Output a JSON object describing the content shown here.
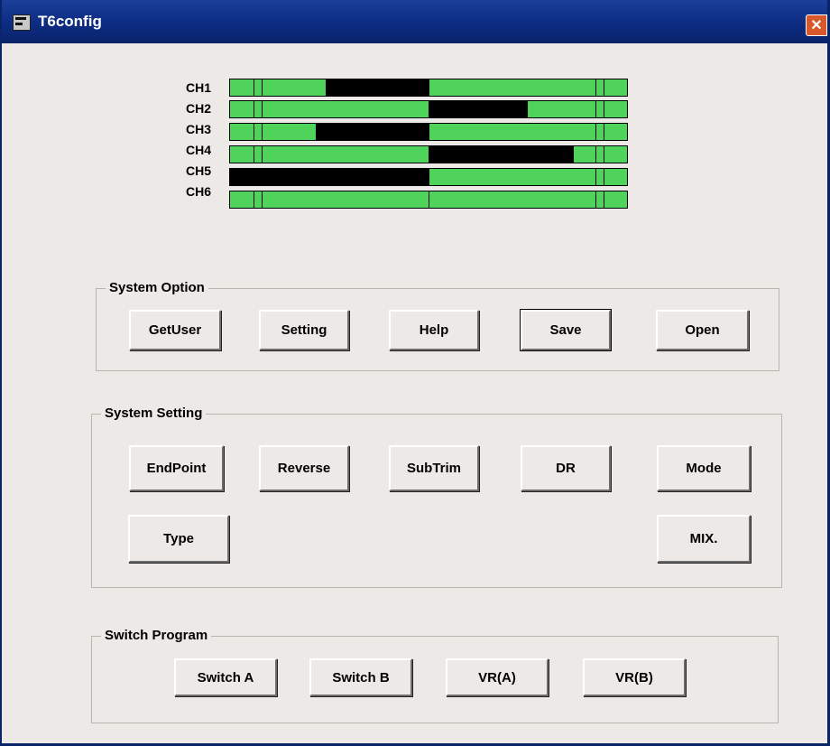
{
  "window": {
    "title": "T6config",
    "close_glyph": "✕"
  },
  "channels": [
    {
      "label": "CH1",
      "fill_start": 0.24,
      "fill_end": 0.5
    },
    {
      "label": "CH2",
      "fill_start": 0.5,
      "fill_end": 0.75
    },
    {
      "label": "CH3",
      "fill_start": 0.215,
      "fill_end": 0.5
    },
    {
      "label": "CH4",
      "fill_start": 0.5,
      "fill_end": 0.865
    },
    {
      "label": "CH5",
      "fill_start": 0.0,
      "fill_end": 0.5
    },
    {
      "label": "CH6",
      "fill_start": 0.5,
      "fill_end": 0.5
    }
  ],
  "system_option": {
    "label": "System Option",
    "buttons": [
      "GetUser",
      "Setting",
      "Help",
      "Save",
      "Open"
    ]
  },
  "system_setting": {
    "label": "System Setting",
    "buttons": [
      "EndPoint",
      "Reverse",
      "SubTrim",
      "DR",
      "Mode",
      "Type",
      "MIX."
    ]
  },
  "switch_program": {
    "label": "Switch Program",
    "buttons": [
      "Switch A",
      "Switch B",
      "VR(A)",
      "VR(B)"
    ]
  },
  "colors": {
    "bar_green": "#4fd35a",
    "titlebar": "#0a246a",
    "face": "#ece9e6"
  },
  "icons": {
    "app": "app-icon",
    "close": "close-icon"
  }
}
